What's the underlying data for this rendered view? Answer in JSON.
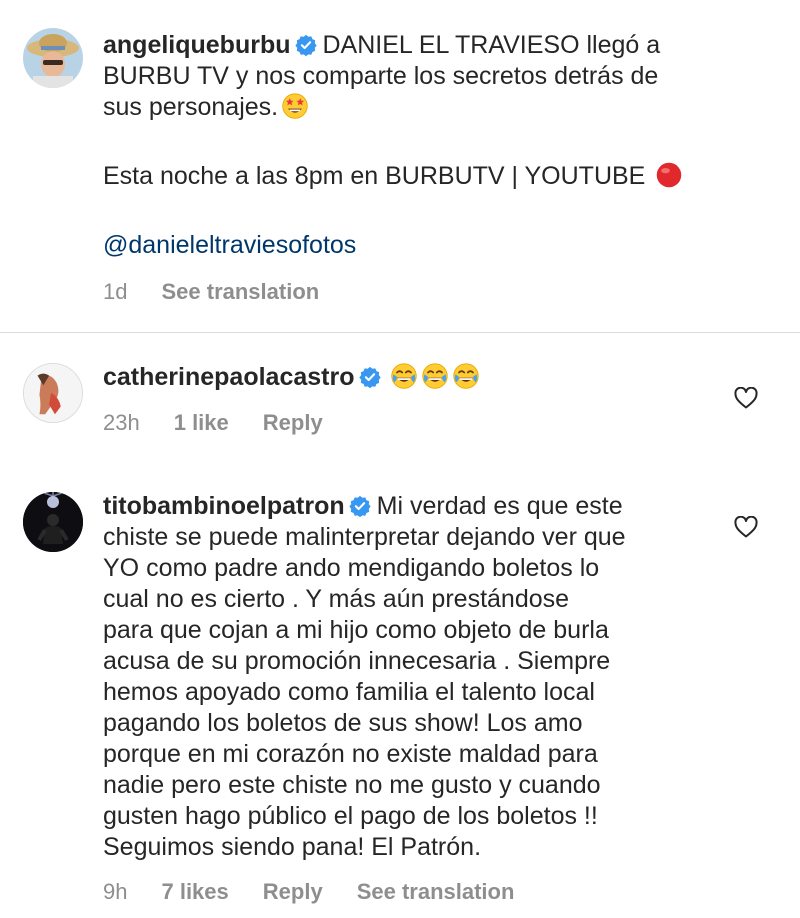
{
  "comments": [
    {
      "username": "angeliqueburbu",
      "verified": true,
      "text_line1": "DANIEL EL TRAVIESO llegó a",
      "text_rest": "BURBU TV y nos comparte los secretos detrás de\nsus personajes.",
      "emoji1": "star-struck-emoji",
      "text_line2": "Esta noche a las 8pm en BURBUTV | YOUTUBE",
      "emoji2": "red-circle-emoji",
      "mention": "@danieleltraviesofotos",
      "time": "1d",
      "see_translation": "See translation"
    },
    {
      "username": "catherinepaolacastro",
      "verified": true,
      "emojis": [
        "joy-emoji",
        "joy-emoji",
        "joy-emoji"
      ],
      "time": "23h",
      "likes": "1 like",
      "reply": "Reply"
    },
    {
      "username": "titobambinoelpatron",
      "verified": true,
      "text_first": "Mi verdad es que este",
      "text_rest": "chiste se puede malinterpretar dejando ver que\nYO como padre ando mendigando boletos lo\ncual no es cierto . Y más aún  prestándose\npara que cojan  a mi hijo como objeto de burla\nacusa de su promoción innecesaria . Siempre\nhemos apoyado como familia  el talento local\npagando los boletos de sus show!  Los amo\nporque en mi corazón no existe maldad para\nnadie pero este chiste no me gusto y cuando\ngusten hago público el pago de los boletos !!\nSeguimos siendo pana! El Patrón.",
      "time": "9h",
      "likes": "7 likes",
      "reply": "Reply",
      "see_translation": "See translation"
    }
  ],
  "colors": {
    "verified": "#3897f0",
    "mention": "#00376b",
    "meta": "#8e8e8e",
    "text": "#262626"
  }
}
